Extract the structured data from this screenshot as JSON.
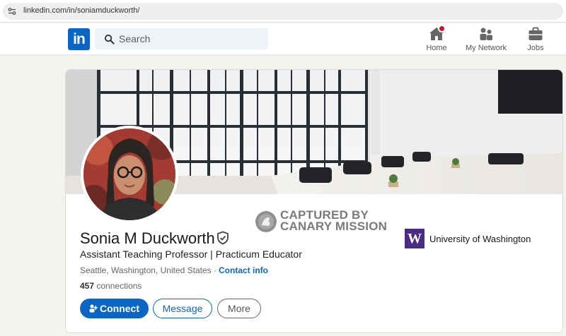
{
  "browser": {
    "url": "linkedin.com/in/soniamduckworth/"
  },
  "nav": {
    "logo_text": "in",
    "search_placeholder": "Search",
    "items": [
      {
        "label": "Home",
        "icon": "home-icon",
        "has_notification": true
      },
      {
        "label": "My Network",
        "icon": "network-icon"
      },
      {
        "label": "Jobs",
        "icon": "briefcase-icon"
      }
    ]
  },
  "profile": {
    "name": "Sonia M Duckworth",
    "headline": "Assistant Teaching Professor | Practicum Educator",
    "location": "Seattle, Washington, United States ·",
    "contact_label": "Contact info",
    "connections_count": "457",
    "connections_label": "connections",
    "education": {
      "logo_text": "W",
      "name": "University of Washington"
    },
    "buttons": {
      "connect": "Connect",
      "message": "Message",
      "more": "More"
    }
  },
  "watermark": {
    "line1": "CAPTURED BY",
    "line2": "CANARY MISSION"
  },
  "colors": {
    "linkedin_blue": "#0a66c2",
    "uw_purple": "#4b2e83",
    "notification_red": "#cb112d"
  }
}
